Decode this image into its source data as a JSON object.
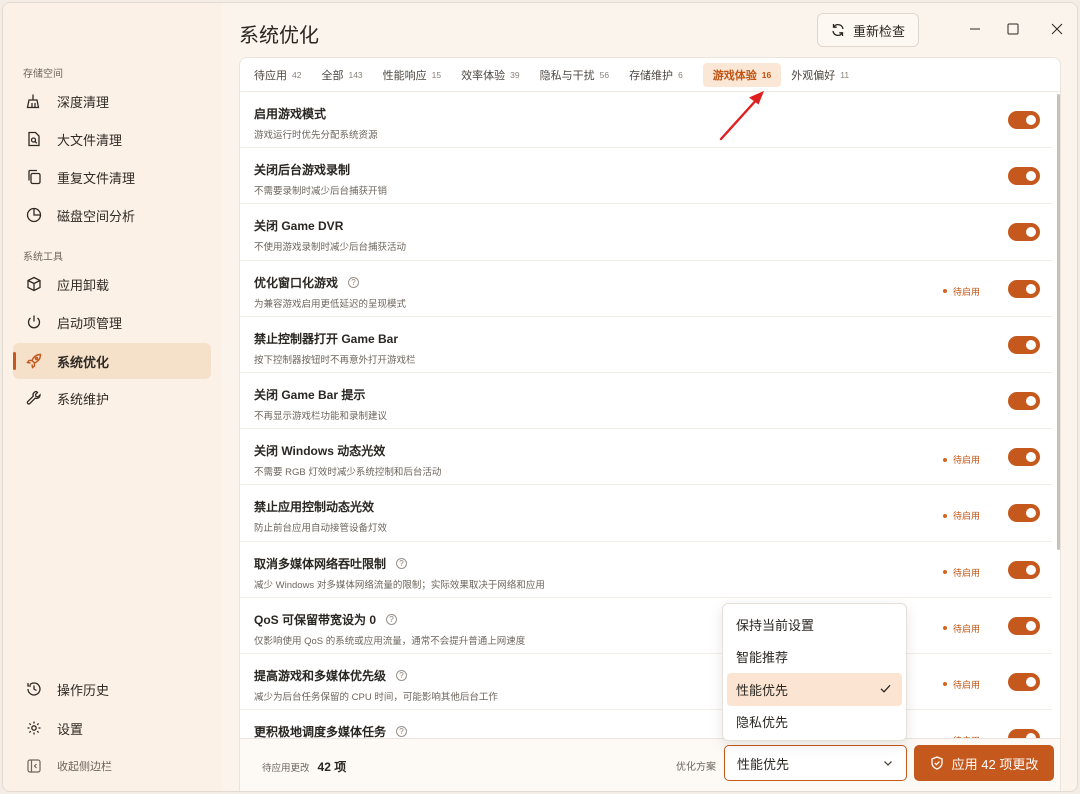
{
  "window": {
    "title": "系统优化",
    "recheck_label": "重新检查"
  },
  "sidebar": {
    "section_storage": "存储空间",
    "section_tools": "系统工具",
    "items": [
      {
        "label": "深度清理",
        "icon": "broom-icon"
      },
      {
        "label": "大文件清理",
        "icon": "file-search-icon"
      },
      {
        "label": "重复文件清理",
        "icon": "copy-icon"
      },
      {
        "label": "磁盘空间分析",
        "icon": "pie-chart-icon"
      },
      {
        "label": "应用卸载",
        "icon": "package-icon"
      },
      {
        "label": "启动项管理",
        "icon": "power-icon"
      },
      {
        "label": "系统优化",
        "icon": "rocket-icon",
        "active": true
      },
      {
        "label": "系统维护",
        "icon": "wrench-icon"
      }
    ],
    "history_label": "操作历史",
    "settings_label": "设置",
    "collapse_label": "收起侧边栏"
  },
  "tabs": [
    {
      "label": "待应用",
      "count": "42"
    },
    {
      "label": "全部",
      "count": "143"
    },
    {
      "label": "性能响应",
      "count": "15"
    },
    {
      "label": "效率体验",
      "count": "39"
    },
    {
      "label": "隐私与干扰",
      "count": "56"
    },
    {
      "label": "存储维护",
      "count": "6"
    },
    {
      "label": "游戏体验",
      "count": "16",
      "active": true
    },
    {
      "label": "外观偏好",
      "count": "11"
    }
  ],
  "rows": [
    {
      "title": "启用游戏模式",
      "desc": "游戏运行时优先分配系统资源",
      "help": false,
      "pending": false
    },
    {
      "title": "关闭后台游戏录制",
      "desc": "不需要录制时减少后台捕获开销",
      "help": false,
      "pending": false
    },
    {
      "title": "关闭 Game DVR",
      "desc": "不使用游戏录制时减少后台捕获活动",
      "help": false,
      "pending": false
    },
    {
      "title": "优化窗口化游戏",
      "desc": "为兼容游戏启用更低延迟的呈现模式",
      "help": true,
      "pending": true
    },
    {
      "title": "禁止控制器打开 Game Bar",
      "desc": "按下控制器按钮时不再意外打开游戏栏",
      "help": false,
      "pending": false
    },
    {
      "title": "关闭 Game Bar 提示",
      "desc": "不再显示游戏栏功能和录制建议",
      "help": false,
      "pending": false
    },
    {
      "title": "关闭 Windows 动态光效",
      "desc": "不需要 RGB 灯效时减少系统控制和后台活动",
      "help": false,
      "pending": true
    },
    {
      "title": "禁止应用控制动态光效",
      "desc": "防止前台应用自动接管设备灯效",
      "help": false,
      "pending": true
    },
    {
      "title": "取消多媒体网络吞吐限制",
      "desc": "减少 Windows 对多媒体网络流量的限制；实际效果取决于网络和应用",
      "help": true,
      "pending": true
    },
    {
      "title": "QoS 可保留带宽设为 0",
      "desc": "仅影响使用 QoS 的系统或应用流量，通常不会提升普通上网速度",
      "help": true,
      "pending": true
    },
    {
      "title": "提高游戏和多媒体优先级",
      "desc": "减少为后台任务保留的 CPU 时间，可能影响其他后台工作",
      "help": true,
      "pending": true
    },
    {
      "title": "更积极地调度多媒体任务",
      "desc": "",
      "help": true,
      "pending": true
    }
  ],
  "pending_text": "待启用",
  "help_glyph": "?",
  "footer": {
    "pending_label": "待应用更改",
    "pending_count": "42 项",
    "plan_label": "优化方案",
    "plan_value": "性能优先",
    "apply_label": "应用 42 项更改"
  },
  "dropdown": {
    "options": [
      "保持当前设置",
      "智能推荐",
      "性能优先",
      "隐私优先"
    ],
    "selected_index": 2
  },
  "colors": {
    "accent": "#c5581c",
    "accent_light": "#fbe5d2",
    "sidebar_bg": "#fbf1e6",
    "annotation_arrow": "#e02020"
  }
}
